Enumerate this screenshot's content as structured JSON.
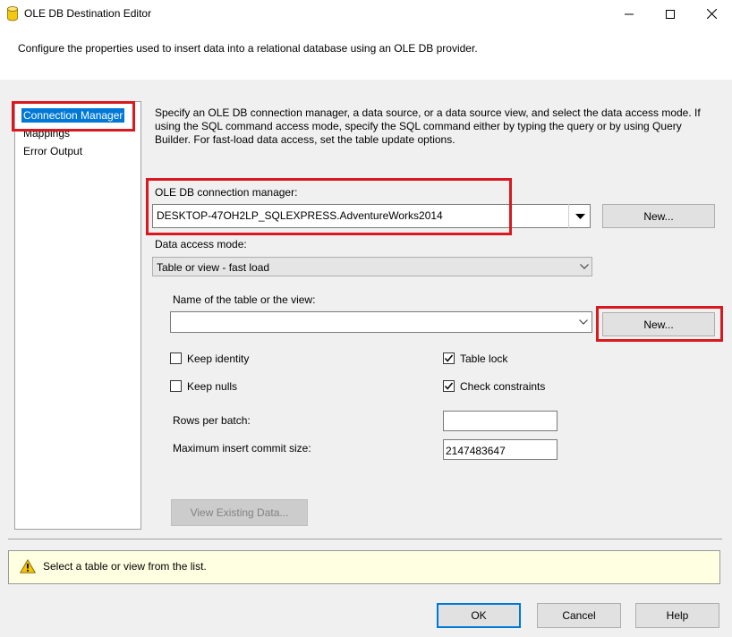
{
  "window": {
    "title": "OLE DB Destination Editor"
  },
  "header": {
    "description": "Configure the properties used to insert data into a relational database using an OLE DB provider."
  },
  "nav": {
    "items": [
      {
        "label": "Connection Manager"
      },
      {
        "label": "Mappings"
      },
      {
        "label": "Error Output"
      }
    ]
  },
  "main": {
    "description": "Specify an OLE DB connection manager, a data source, or a data source view, and select the data access mode. If using the SQL command access mode, specify the SQL command either by typing the query or by using Query Builder. For fast-load data access, set the table update options.",
    "connection_manager_label": "OLE DB connection manager:",
    "connection_manager_value": "DESKTOP-47OH2LP_SQLEXPRESS.AdventureWorks2014",
    "new_connection_label": "New...",
    "data_access_mode_label": "Data access mode:",
    "data_access_mode_value": "Table or view - fast load",
    "table_name_label": "Name of the table or the view:",
    "table_name_value": "",
    "new_table_label": "New...",
    "keep_identity_label": "Keep identity",
    "keep_identity_checked": false,
    "keep_nulls_label": "Keep nulls",
    "keep_nulls_checked": false,
    "table_lock_label": "Table lock",
    "table_lock_checked": true,
    "check_constraints_label": "Check constraints",
    "check_constraints_checked": true,
    "rows_per_batch_label": "Rows per batch:",
    "rows_per_batch_value": "",
    "max_commit_label": "Maximum insert commit size:",
    "max_commit_value": "2147483647",
    "view_existing_label": "View Existing Data..."
  },
  "message": {
    "text": "Select a table or view from the list.",
    "icon": "warning-icon"
  },
  "footer": {
    "ok_label": "OK",
    "cancel_label": "Cancel",
    "help_label": "Help"
  },
  "colors": {
    "highlight": "#d9191f",
    "selection": "#0078d7",
    "message_background": "#ffffe1"
  }
}
